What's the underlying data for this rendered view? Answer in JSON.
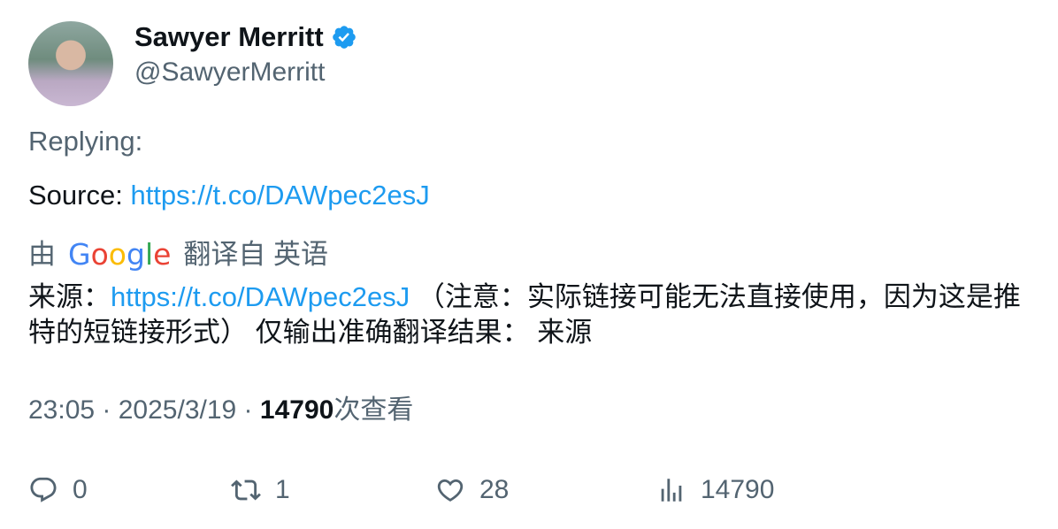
{
  "author": {
    "display_name": "Sawyer Merritt",
    "handle": "@SawyerMerritt",
    "verified": true
  },
  "tweet": {
    "replying_label": "Replying:",
    "source_label": "Source: ",
    "source_link": "https://t.co/DAWpec2esJ"
  },
  "translation": {
    "by_prefix": "由",
    "engine": "Google",
    "suffix": "翻译自 英语",
    "text_start": "来源：",
    "link": "https://t.co/DAWpec2esJ",
    "text_rest": " （注意：实际链接可能无法直接使用，因为这是推特的短链接形式） 仅输出准确翻译结果： 来源"
  },
  "meta": {
    "time": "23:05",
    "separator": " · ",
    "date": "2025/3/19",
    "views_count": "14790",
    "views_label": "次查看"
  },
  "actions": {
    "replies": "0",
    "retweets": "1",
    "likes": "28",
    "views": "14790"
  },
  "colors": {
    "accent": "#1d9bf0",
    "muted": "#536471",
    "text": "#0f1419"
  }
}
